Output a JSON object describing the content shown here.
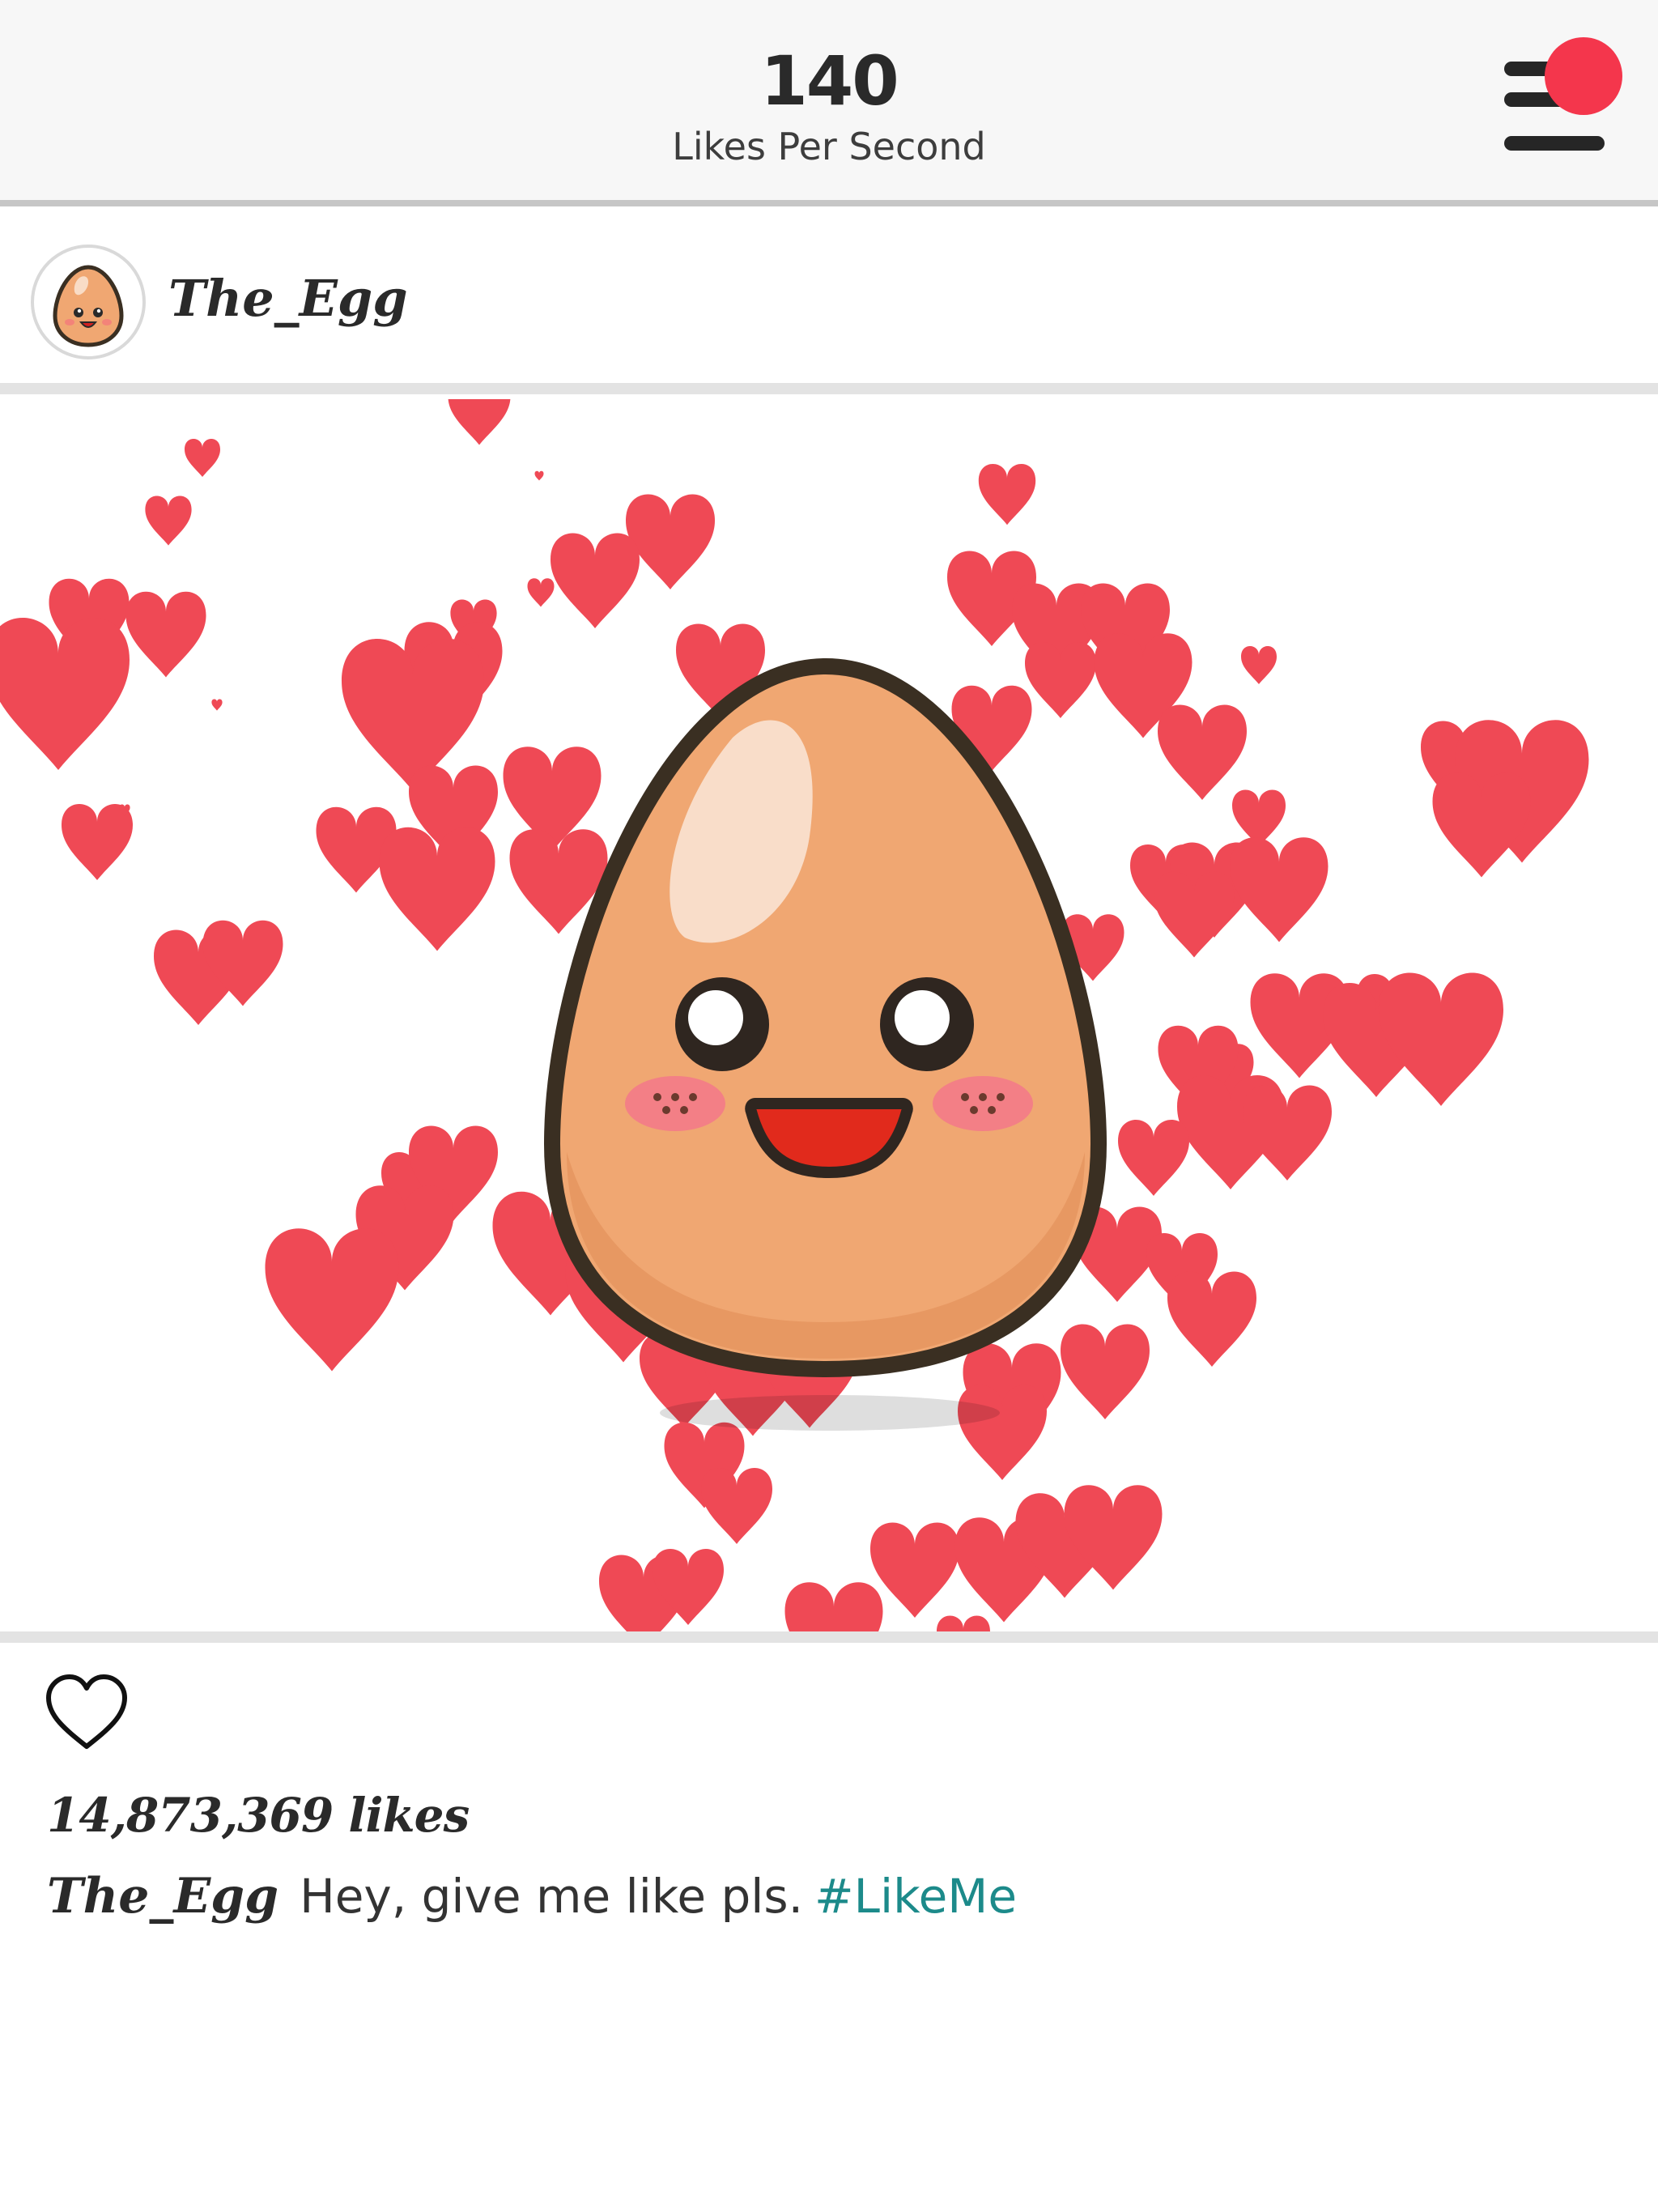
{
  "header": {
    "likes_per_second_value": "140",
    "likes_per_second_label": "Likes Per Second",
    "notification_color": "#f4364c"
  },
  "post": {
    "username": "The_Egg",
    "likes_text": "14,873,369 likes",
    "caption_user": "The_Egg",
    "caption_text": "Hey, give me like pls.",
    "caption_hashtag": "#LikeMe",
    "image": {
      "character": "kawaii-egg",
      "heart_color": "#ef4955",
      "egg_fill": "#f0a772",
      "egg_outline": "#3a2f22"
    }
  },
  "icons": {
    "menu": "hamburger-menu-icon",
    "like": "heart-outline-icon",
    "avatar": "egg-avatar-icon"
  }
}
